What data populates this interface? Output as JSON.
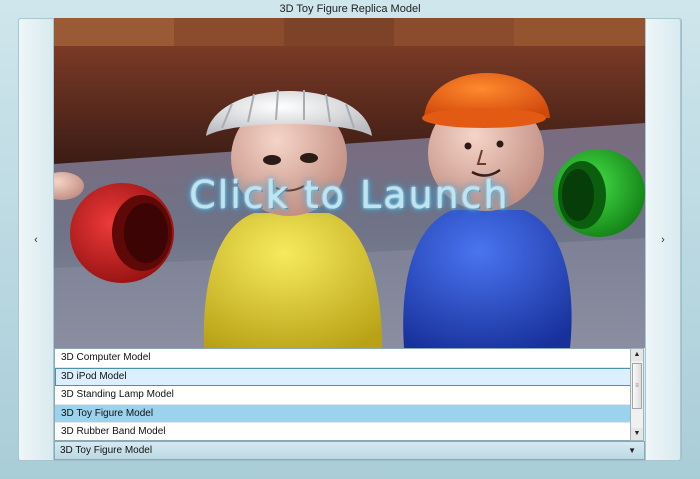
{
  "window": {
    "title": "3D Toy Figure Replica Model"
  },
  "nav": {
    "prev_glyph": "‹",
    "next_glyph": "›",
    "prev_icon": "chevron-left-icon",
    "next_icon": "chevron-right-icon"
  },
  "viewport": {
    "overlay_text": "Click to Launch",
    "overlay_color": "#bfe4f2"
  },
  "model_list": {
    "items": [
      {
        "label": "3D Computer Model"
      },
      {
        "label": "3D iPod Model"
      },
      {
        "label": "3D Standing Lamp Model"
      },
      {
        "label": "3D Toy Figure Model"
      },
      {
        "label": "3D Rubber Band Model"
      }
    ],
    "focused_index": 1,
    "selected_index": 3,
    "scroll_up_glyph": "▲",
    "scroll_down_glyph": "▼",
    "thumb_glyph": "≡"
  },
  "combo": {
    "value": "3D Toy Figure Model",
    "arrow_glyph": "▼"
  },
  "colors": {
    "accent": "#9bd2ee",
    "frame": "#cfe6ec"
  }
}
